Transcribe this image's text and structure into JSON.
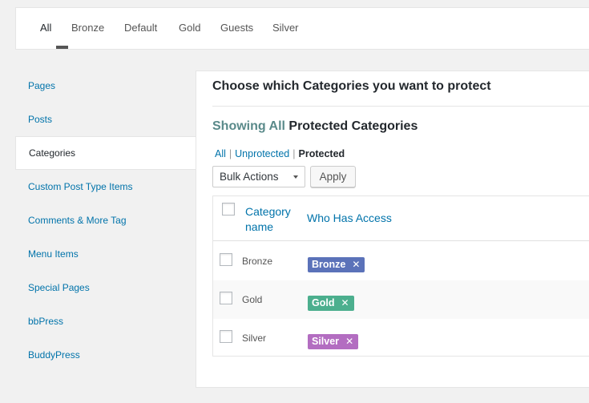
{
  "tabs": [
    {
      "label": "All",
      "active": true
    },
    {
      "label": "Bronze"
    },
    {
      "label": "Default"
    },
    {
      "label": "Gold"
    },
    {
      "label": "Guests"
    },
    {
      "label": "Silver"
    }
  ],
  "sidebar": {
    "items": [
      {
        "label": "Pages"
      },
      {
        "label": "Posts"
      },
      {
        "label": "Categories",
        "active": true
      },
      {
        "label": "Custom Post Type Items"
      },
      {
        "label": "Comments & More Tag"
      },
      {
        "label": "Menu Items"
      },
      {
        "label": "Special Pages"
      },
      {
        "label": "bbPress"
      },
      {
        "label": "BuddyPress"
      }
    ]
  },
  "panel": {
    "title": "Choose which Categories you want to protect",
    "showing_prefix": "Showing All",
    "showing_suffix": "Protected Categories",
    "filters": {
      "all": "All",
      "unprotected": "Unprotected",
      "protected": "Protected",
      "separator": "|"
    },
    "bulk_actions": "Bulk Actions",
    "apply": "Apply",
    "table": {
      "col_name": "Category name",
      "col_access": "Who Has Access",
      "rows": [
        {
          "name": "Bronze",
          "access": "Bronze",
          "color": "#5b72b9"
        },
        {
          "name": "Gold",
          "access": "Gold",
          "color": "#4caf8e"
        },
        {
          "name": "Silver",
          "access": "Silver",
          "color": "#b36dc1"
        }
      ],
      "remove_glyph": "✕"
    }
  }
}
